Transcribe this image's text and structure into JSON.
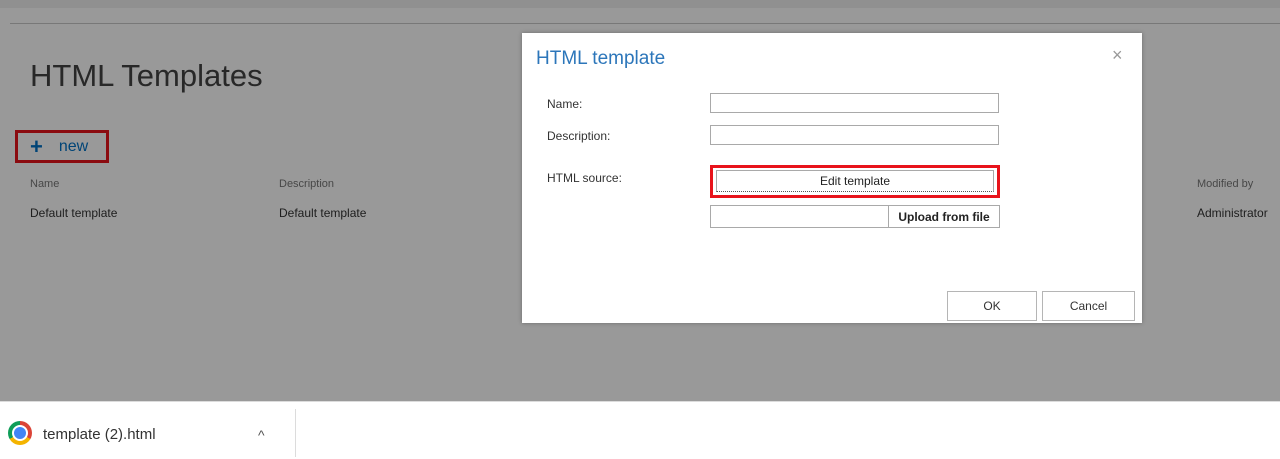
{
  "page": {
    "title": "HTML Templates",
    "new_label": "new",
    "columns": [
      "Name",
      "Description",
      "Modified by"
    ],
    "rows": [
      {
        "name": "Default template",
        "description": "Default template",
        "modified_by": "Administrator"
      }
    ]
  },
  "dialog": {
    "title": "HTML template",
    "close_glyph": "×",
    "name_label": "Name:",
    "name_value": "",
    "description_label": "Description:",
    "description_value": "",
    "source_label": "HTML source:",
    "edit_button": "Edit template",
    "upload_button": "Upload from file",
    "ok_button": "OK",
    "cancel_button": "Cancel"
  },
  "download_bar": {
    "file_name": "template (2).html",
    "chevron": "^"
  },
  "colors": {
    "accent": "#0072c6",
    "highlight": "#e8131b",
    "dialog_title": "#2c76ba"
  }
}
